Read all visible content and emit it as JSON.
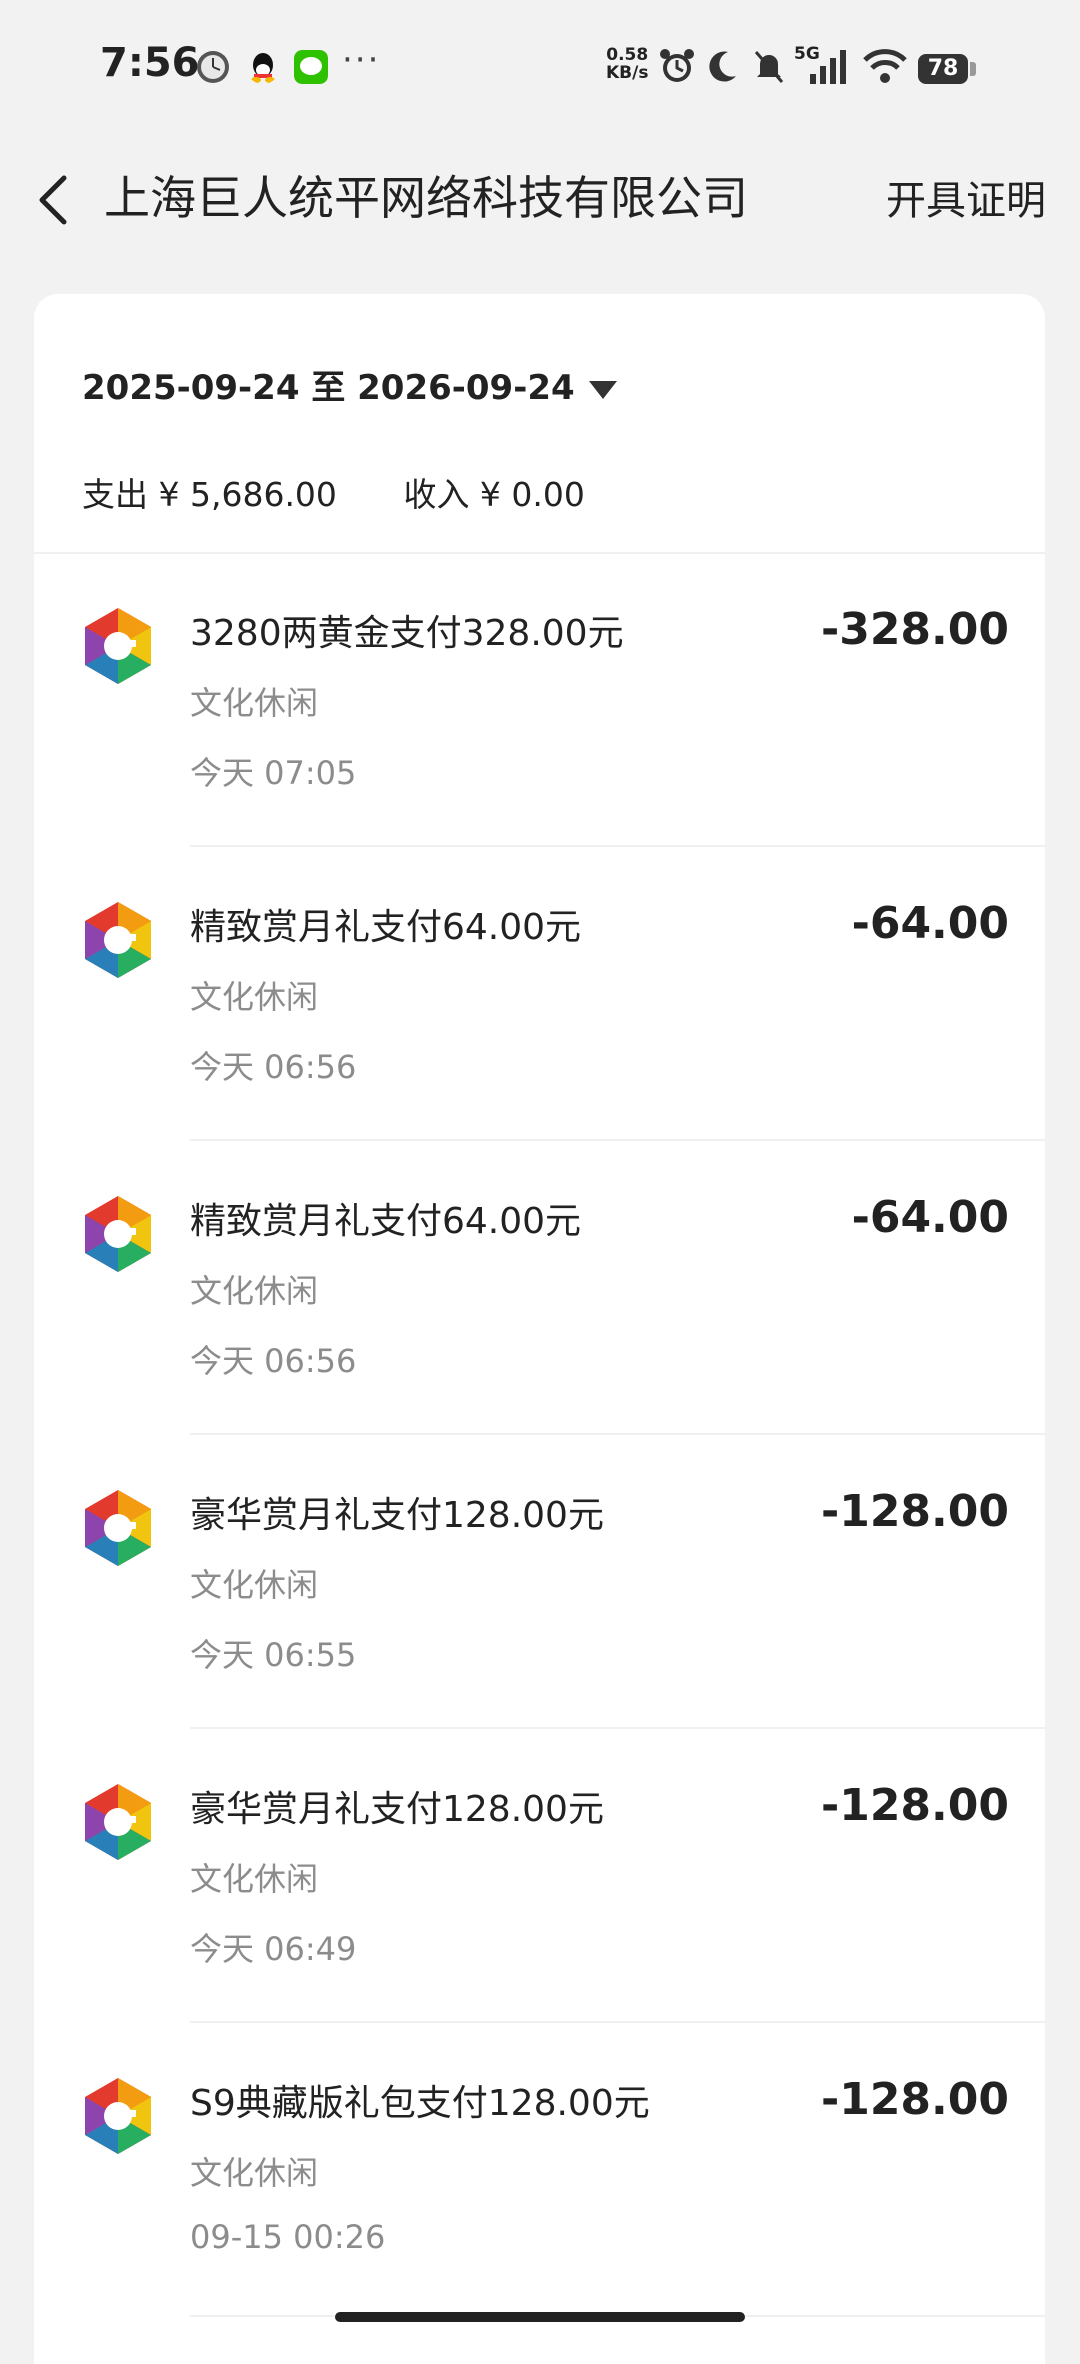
{
  "status_bar": {
    "time": "7:56",
    "net_speed_value": "0.58",
    "net_speed_unit": "KB/s",
    "network": "5G",
    "battery": "78",
    "icons": [
      "clock-app-icon",
      "qq-icon",
      "wechat-icon",
      "alarm-icon",
      "moon-icon",
      "mute-icon",
      "signal-icon",
      "wifi-icon"
    ]
  },
  "header": {
    "title": "上海巨人统平网络科技有限公司",
    "action": "开具证明"
  },
  "filter": {
    "date_range": "2025-09-24 至 2026-09-24"
  },
  "summary": {
    "expense": "支出 ¥ 5,686.00",
    "income": "收入 ¥ 0.00"
  },
  "transactions": [
    {
      "title": "3280两黄金支付328.00元",
      "category": "文化休闲",
      "time": "今天 07:05",
      "amount": "-328.00"
    },
    {
      "title": "精致赏月礼支付64.00元",
      "category": "文化休闲",
      "time": "今天 06:56",
      "amount": "-64.00"
    },
    {
      "title": "精致赏月礼支付64.00元",
      "category": "文化休闲",
      "time": "今天 06:56",
      "amount": "-64.00"
    },
    {
      "title": "豪华赏月礼支付128.00元",
      "category": "文化休闲",
      "time": "今天 06:55",
      "amount": "-128.00"
    },
    {
      "title": "豪华赏月礼支付128.00元",
      "category": "文化休闲",
      "time": "今天 06:49",
      "amount": "-128.00"
    },
    {
      "title": "S9典藏版礼包支付128.00元",
      "category": "文化休闲",
      "time": "09-15 00:26",
      "amount": "-128.00"
    }
  ],
  "colors": {
    "background": "#f2f2f2",
    "card": "#ffffff",
    "text": "#222222",
    "secondary_text": "#8c8c8c"
  }
}
